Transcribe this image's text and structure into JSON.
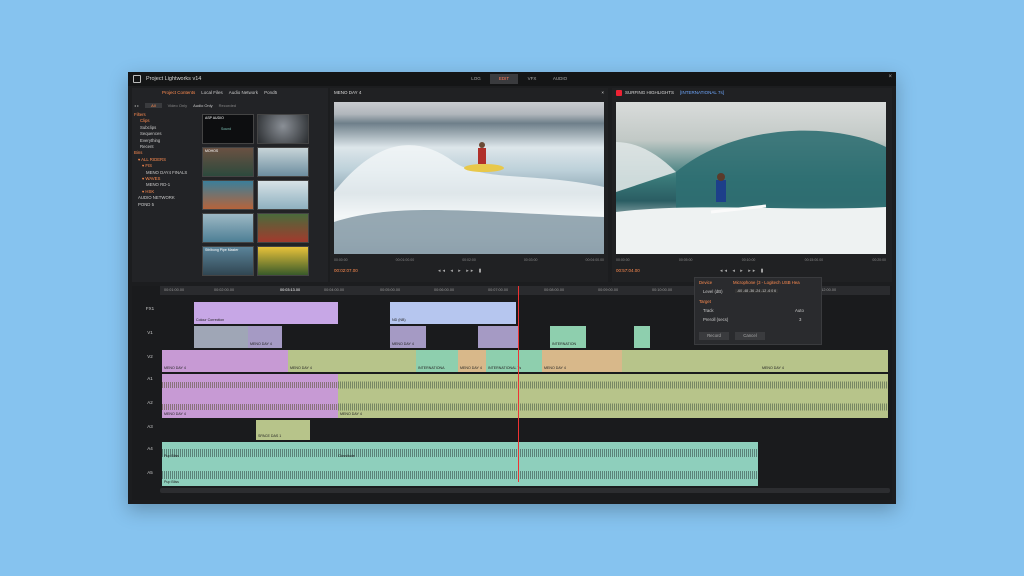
{
  "app": {
    "title": "Project Lightworks v14"
  },
  "modes": [
    {
      "label": "LOG",
      "active": false
    },
    {
      "label": "EDIT",
      "active": true
    },
    {
      "label": "VFX",
      "active": false
    },
    {
      "label": "AUDIO",
      "active": false
    }
  ],
  "browser": {
    "tabs": [
      {
        "label": "Project Contents",
        "active": true
      },
      {
        "label": "Local Files",
        "active": false
      },
      {
        "label": "Audio Network",
        "active": false
      },
      {
        "label": "Pond5",
        "active": false
      }
    ],
    "filters": [
      "All",
      "Video Only",
      "Audio Only",
      "Recorded"
    ],
    "tree": [
      {
        "label": "Filters",
        "color": "orange"
      },
      {
        "label": "Clips",
        "color": "orange"
      },
      {
        "label": "Subclips",
        "color": "grey"
      },
      {
        "label": "Sequences",
        "color": "grey"
      },
      {
        "label": "Everything",
        "color": "grey"
      },
      {
        "label": "Recent",
        "color": "grey"
      },
      {
        "label": "Bins",
        "color": "orange"
      },
      {
        "label": "▾ ALL RIDERS",
        "color": "orange"
      },
      {
        "label": "▾ FIS",
        "color": "orange"
      },
      {
        "label": "MENO DAY4 FINALS",
        "color": "grey"
      },
      {
        "label": "▾ WAVES",
        "color": "orange"
      },
      {
        "label": "MENO RD-1",
        "color": "grey"
      },
      {
        "label": "▾ HSK",
        "color": "orange"
      },
      {
        "label": "AUDIO NETWORK",
        "color": "grey"
      },
      {
        "label": "POND 5",
        "color": "grey"
      }
    ],
    "thumbs": [
      "ASP AUDIO",
      "",
      "MOHOS",
      "",
      "",
      "",
      "",
      "",
      "Sthlbong Pipe Master",
      ""
    ],
    "thumb_sub": "Sound"
  },
  "viewer_left": {
    "title": "MENO DAY 4",
    "time": "00:02:07.00",
    "ruler": [
      "00:00:00",
      "00:01:00.00",
      "00:02:00",
      "00:03:00",
      "00:04:00.00"
    ]
  },
  "viewer_right": {
    "title": "SURFING HIGHLIGHTS",
    "subtitle": "[INTERNATIONAL 7s]",
    "time": "00:57:04.00",
    "ruler": [
      "00:00:00",
      "00:05:00",
      "00:10:00",
      "00:15:00.00",
      "00:20:00"
    ]
  },
  "timeline": {
    "ruler": [
      "00:01:00.00",
      "00:02:00.00",
      "00:03:13.00",
      "00:04:00.00",
      "00:05:00.00",
      "00:06:00.00",
      "00:07:00.00",
      "00:08:00.00",
      "00:09:00.00",
      "00:10:00.00",
      "00:11:00.00",
      "00:12:00.00"
    ],
    "tracks": [
      "FX1",
      "V1",
      "V2",
      "A1",
      "A2",
      "A3",
      "A4",
      "A5"
    ],
    "clips": {
      "colour": "Colour Correction",
      "nd": "ND (NB)",
      "v1a": "MENO DAY 4",
      "v1b": "MENO DAY 4",
      "v1c": "INTERNATION",
      "v2a": "MENO DAY 4",
      "v2b": "MENO DAY 4",
      "v2c": "INTERNATIONA",
      "v2d": "MENO DAY 4",
      "v2e": "INTERNATIONAL 7s",
      "v2f": "MENO DAY 4",
      "v2g": "MENO DAY 4",
      "a1": "MENO DAY 4",
      "a1b": "MENO DAY 4",
      "a3": "SPACE DAS 1",
      "a4": "Pup Bliss",
      "a4b": "Clossitude",
      "a5": "Pup Bliss"
    }
  },
  "record_panel": {
    "device_label": "Device",
    "device": "Microphone (3 - Logitech USB Hea",
    "level_label": "Level (dB)",
    "level": "-60 -48 -36 -24 -12 -6 0 6",
    "target": "Target",
    "track_label": "Track",
    "track": "Auto",
    "preroll_label": "Preroll (secs)",
    "preroll": "3",
    "record": "Record",
    "cancel": "Cancel"
  }
}
